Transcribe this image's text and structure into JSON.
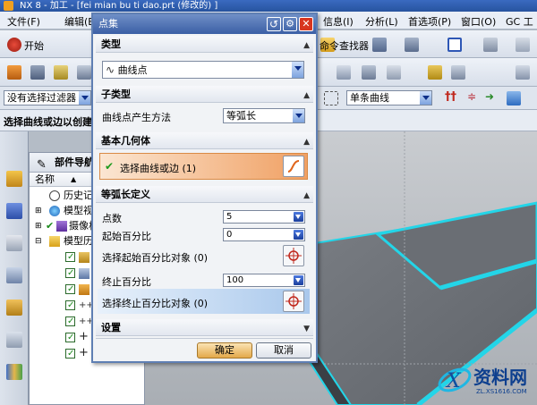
{
  "window": {
    "title": "NX 8 - 加工 - [fei mian bu ti dao.prt  (修改的)  ]"
  },
  "menu": {
    "items": [
      "文件(F)",
      "编辑(E)",
      "信息(I)",
      "分析(L)",
      "首选项(P)",
      "窗口(O)",
      "GC 工具箱"
    ]
  },
  "toolbar": {
    "start_label": "开始",
    "command_finder": "命令查找器"
  },
  "selection_bar": {
    "filter_value": "没有选择过滤器",
    "curve_rule_value": "单条曲线"
  },
  "cue_line": "选择曲线或边以创建",
  "navigator": {
    "title": "部件导航器",
    "column_name": "名称",
    "rows": [
      "历史记录",
      "模型视图",
      "摄像机",
      "模型历史记录"
    ]
  },
  "dialog": {
    "title": "点集",
    "type_section": "类型",
    "type_value": "曲线点",
    "subtype_section": "子类型",
    "subtype_label": "曲线点产生方法",
    "subtype_value": "等弧长",
    "base_geometry_section": "基本几何体",
    "select_curve_label": "选择曲线或边 (1)",
    "arc_length_section": "等弧长定义",
    "point_count_label": "点数",
    "point_count_value": "5",
    "start_percent_label": "起始百分比",
    "start_percent_value": "0",
    "select_start_object_label": "选择起始百分比对象  (0)",
    "end_percent_label": "终止百分比",
    "end_percent_value": "100",
    "select_end_object_label": "选择终止百分比对象  (0)",
    "settings_section": "设置",
    "ok_label": "确定",
    "cancel_label": "取消"
  },
  "watermark": {
    "text": "资料网",
    "url": "ZL.XS1616.COM"
  },
  "colors": {
    "title_bar": "#2f5fb5",
    "dialog_title": "#4a6fb3",
    "highlight_orange": "#f0a063",
    "highlight_blue": "#a9c8ec",
    "model_cyan": "#23d5e8",
    "model_gray": "#6d7177"
  }
}
